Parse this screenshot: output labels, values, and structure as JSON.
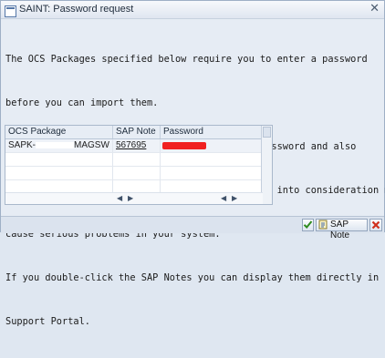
{
  "window": {
    "title": "SAINT: Password request"
  },
  "message": {
    "lines": [
      "The OCS Packages specified below require you to enter a password",
      "before you can import them.",
      "The specified SAP Notes contain the relevant password and also",
      "important information, which if you do not take into consideration may",
      "cause serious problems in your system.",
      "If you double-click the SAP Notes you can display them directly in SAP",
      "Support Portal."
    ]
  },
  "table": {
    "headers": {
      "package": "OCS Package",
      "note": "SAP Note",
      "password": "Password"
    },
    "rows": [
      {
        "package_prefix": "SAPK-",
        "package_suffix": "MAGSW",
        "note": "567695"
      }
    ]
  },
  "buttons": {
    "sap_note": "SAP Note"
  },
  "icons": {
    "title": "sap-window-icon",
    "ok": "checkmark-icon",
    "sap_note": "note-icon",
    "cancel": "cancel-x-icon"
  },
  "colors": {
    "ok_green": "#2e8b1e",
    "cancel_red": "#d0301c"
  }
}
